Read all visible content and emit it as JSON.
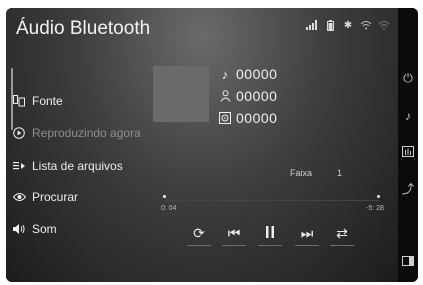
{
  "header": {
    "title": "Áudio Bluetooth"
  },
  "status_icons": [
    "signal-bars-icon",
    "battery-icon",
    "bluetooth-icon",
    "wifi-icon",
    "wifi-alt-icon"
  ],
  "menu": [
    {
      "label": "Fonte",
      "icon": "phone-source-icon",
      "active": false
    },
    {
      "label": "Reproduzindo agora",
      "icon": "play-circle-icon",
      "active": true
    },
    {
      "label": "Lista de arquivos",
      "icon": "list-play-icon",
      "active": false
    },
    {
      "label": "Procurar",
      "icon": "eye-icon",
      "active": false
    },
    {
      "label": "Som",
      "icon": "speaker-icon",
      "active": false
    }
  ],
  "now_playing": {
    "title": "00000",
    "artist": "00000",
    "album": "00000",
    "track_label": "Faixa",
    "track_number": "1",
    "time_elapsed": "0: 04",
    "time_remaining": "-5: 28",
    "progress": 0.0
  },
  "controls": [
    "repeat-icon",
    "previous-icon",
    "pause-icon",
    "next-icon",
    "shuffle-icon"
  ],
  "right_rail": [
    "power-icon",
    "music-note-icon",
    "equalizer-icon",
    "route-icon",
    "screen-off-icon"
  ]
}
